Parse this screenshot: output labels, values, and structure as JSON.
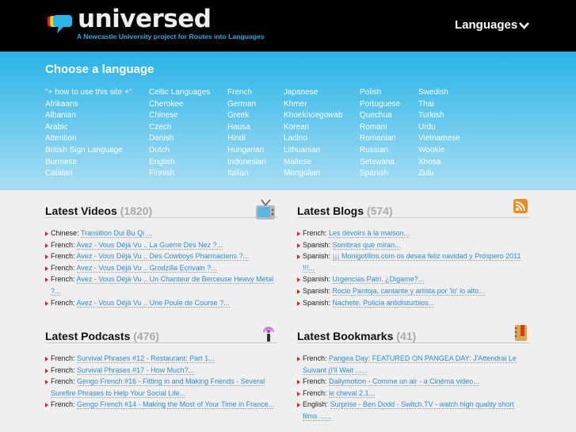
{
  "header": {
    "logo_text": "universed",
    "tagline": "A Newcastle University project for Routes into Languages",
    "languages_button": "Languages"
  },
  "choose": {
    "title": "Choose a language",
    "columns": [
      [
        "\"+ how to use this site +\"",
        "Afrikaans",
        "Albanian",
        "Arabic",
        "Attention",
        "British Sign Language",
        "Burmese",
        "Catalan"
      ],
      [
        "Celtic Languages",
        "Cherokee",
        "Chinese",
        "Czech",
        "Danish",
        "Dutch",
        "English",
        "Finnish"
      ],
      [
        "French",
        "German",
        "Greek",
        "Hausa",
        "Hindi",
        "Hungarian",
        "Indonesian",
        "Italian"
      ],
      [
        "Japanese",
        "Khmer",
        "Khoekhoegowab",
        "Korean",
        "Ladino",
        "Lithuanian",
        "Maltese",
        "Mongolian"
      ],
      [
        "Polish",
        "Portuguese",
        "Quechua",
        "Romani",
        "Romanian",
        "Russian",
        "Setswana",
        "Spanish"
      ],
      [
        "Swedish",
        "Thai",
        "Turkish",
        "Urdu",
        "Vietnamese",
        "Wookie",
        "Xhosa",
        "Zulu"
      ]
    ]
  },
  "sections": [
    {
      "title": "Latest Videos",
      "count": "(1820)",
      "icon": "tv-icon",
      "items": [
        {
          "lang": "Chinese:",
          "text": "Transition      Dui Bu Qi          ..."
        },
        {
          "lang": "French:",
          "text": "Avez - Vous Déjà Vu .. La Guerre Des Nez ?..."
        },
        {
          "lang": "French:",
          "text": "Avez - Vous Déjà Vu .. Des Cowboys Pharmaciens ?..."
        },
        {
          "lang": "French:",
          "text": "Avez - Vous Déjà Vu .. Grodzilla Ecrivain ?..."
        },
        {
          "lang": "French:",
          "text": "Avez - Vous Déjà Vu .. Un Chanteur de Berceuse Heavy Metal ?..."
        },
        {
          "lang": "French:",
          "text": "Avez - Vous Déjà Vu .. Une Poule de Course ?..."
        }
      ]
    },
    {
      "title": "Latest Blogs",
      "count": "(574)",
      "icon": "rss-icon",
      "items": [
        {
          "lang": "French:",
          "text": "Les devoirs à la maison..."
        },
        {
          "lang": "Spanish:",
          "text": "Sombras que miran..."
        },
        {
          "lang": "Spanish:",
          "text": "¡¡¡ Monigotillos.com os desea feliz navidad y Próspero 2011 !!!..."
        },
        {
          "lang": "Spanish:",
          "text": "Urgencias Patri. ¿Digame?..."
        },
        {
          "lang": "Spanish:",
          "text": "Rocio Pantoja, cantante y artista por 'lo' lo alto..."
        },
        {
          "lang": "Spanish:",
          "text": "Nachete. Policía antidisturbios..."
        }
      ]
    },
    {
      "title": "Latest Podcasts",
      "count": "(476)",
      "icon": "podcast-icon",
      "items": [
        {
          "lang": "French:",
          "text": "Survival Phrases #12 - Restaurant: Part 1..."
        },
        {
          "lang": "French:",
          "text": "Survival Phrases #17 - How Much?..."
        },
        {
          "lang": "French:",
          "text": "Gengo French #16 - Fitting in and Making Friends - Several Surefire Phrases to Help Your Social Life..."
        },
        {
          "lang": "French:",
          "text": "Gengo French #14 - Making the Most of Your Time in France..."
        }
      ]
    },
    {
      "title": "Latest Bookmarks",
      "count": "(41)",
      "icon": "bookmark-icon",
      "items": [
        {
          "lang": "French:",
          "text": "Pangea Day: FEATURED ON PANGEA DAY: J'Attendrai Le Suivant (I'll Wait ......"
        },
        {
          "lang": "French:",
          "text": "Dailymotion - Comme un air - a Cinéma video..."
        },
        {
          "lang": "French:",
          "text": "le cheval 2.1..."
        },
        {
          "lang": "English:",
          "text": "Surprise - Ben Dodd - Switch.TV - watch high quality short films ......"
        }
      ]
    }
  ]
}
